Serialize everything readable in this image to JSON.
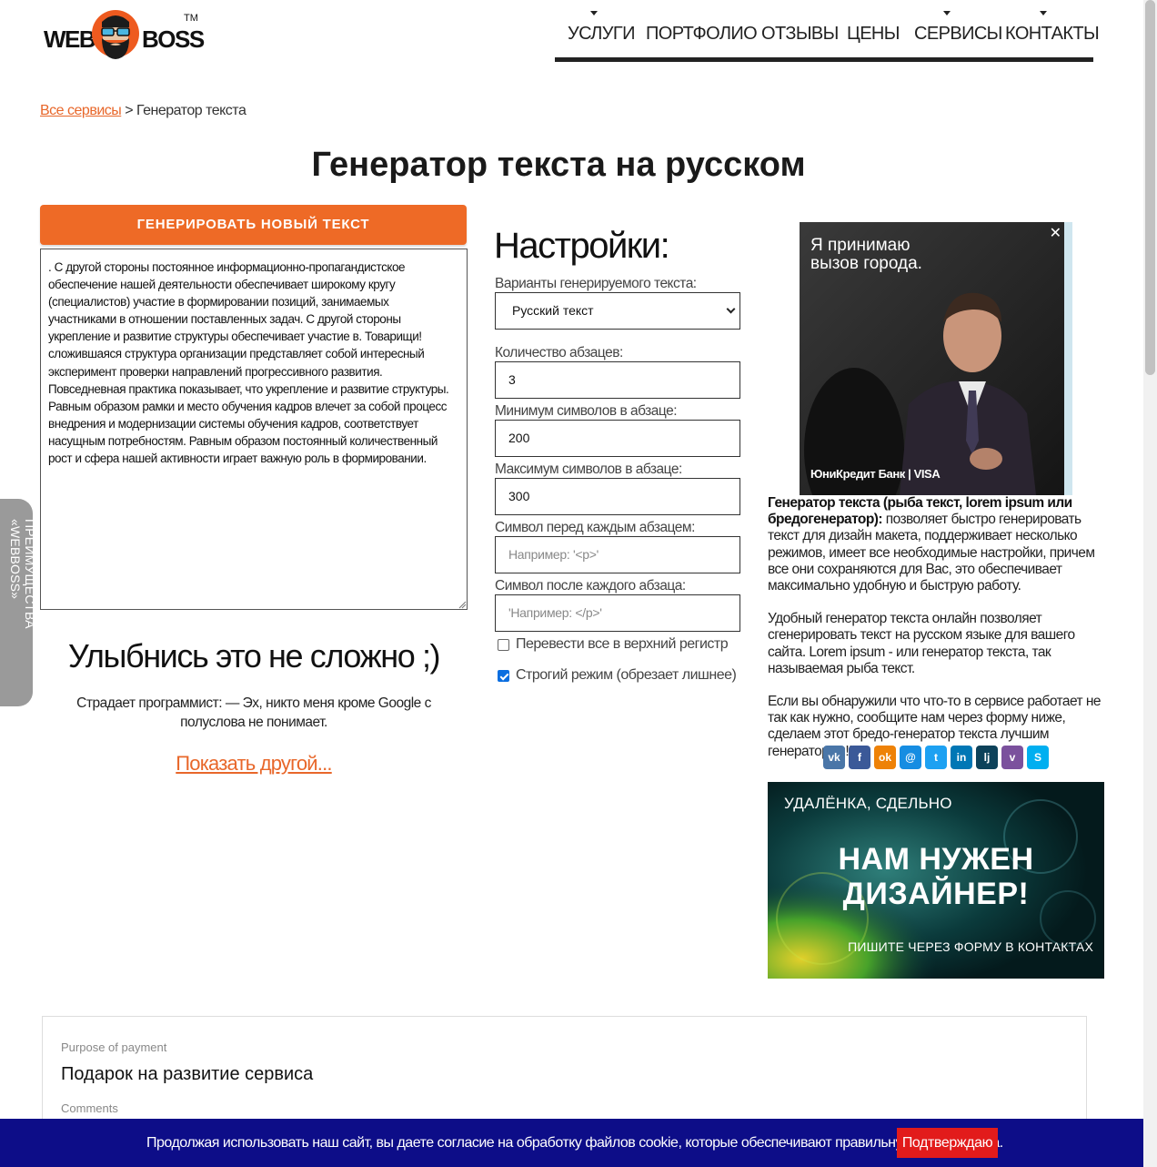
{
  "logo": {
    "left_text": "WEB",
    "right_text": "BOSS",
    "tm": "TM"
  },
  "nav": {
    "items": [
      {
        "label": "Услуги",
        "has_dropdown": true
      },
      {
        "label": "Портфолио",
        "has_dropdown": false
      },
      {
        "label": "Отзывы",
        "has_dropdown": false
      },
      {
        "label": "Цены",
        "has_dropdown": false
      },
      {
        "label": "Сервисы",
        "has_dropdown": true
      },
      {
        "label": "Контакты",
        "has_dropdown": true
      }
    ]
  },
  "breadcrumb": {
    "link": "Все сервисы",
    "separator": ">",
    "current": "Генератор текста"
  },
  "page_title": "Генератор текста на русском",
  "generator": {
    "button_label": "ГЕНЕРИРОВАТЬ НОВЫЙ ТЕКСТ",
    "output_text": ". С другой стороны постоянное информационно-пропагандистское обеспечение нашей деятельности обеспечивает широкому кругу (специалистов) участие в формировании позиций, занимаемых участниками в отношении поставленных задач. С другой стороны укрепление и развитие структуры обеспечивает участие в. Товарищи! сложившаяся структура организации представляет собой интересный эксперимент проверки направлений прогрессивного развития. Повседневная практика показывает, что укрепление и развитие структуры.\nРавным образом рамки и место обучения кадров влечет за собой процесс внедрения и модернизации системы обучения кадров, соответствует насущным потребностям. Равным образом постоянный количественный рост и сфера нашей активности играет важную роль в формировании."
  },
  "joke": {
    "title": "Улыбнись это не сложно ;)",
    "text": "Страдает программист: — Эх, никто меня кроме Google с полуслова не понимает.",
    "more_link": "Показать другой..."
  },
  "settings": {
    "title": "Настройки:",
    "variant_label": "Варианты генерируемого текста:",
    "variant_value": "Русский текст",
    "paragraphs_label": "Количество абзацев:",
    "paragraphs_value": "3",
    "min_label": "Минимум символов в абзаце:",
    "min_value": "200",
    "max_label": "Максимум символов в абзаце:",
    "max_value": "300",
    "before_label": "Символ перед каждым абзацем:",
    "before_placeholder": "Например: '<p>'",
    "after_label": "Символ после каждого абзаца:",
    "after_placeholder": "'Например: </p>'",
    "uppercase_label": "Перевести все в верхний регистр",
    "uppercase_checked": false,
    "strict_label": "Строгий режим (обрезает лишнее)",
    "strict_checked": true
  },
  "ad_top": {
    "text": "Я принимаю\nвызов города.",
    "brand": "ЮниКредит Банк | VISA",
    "close": "✕"
  },
  "description": {
    "bold": "Генератор текста (рыба текст, lorem ipsum или бредогенератор):",
    "p1": "позволяет быстро генерировать текст для дизайн макета, поддерживает несколько режимов, имеет все необходимые настройки, причем все они сохраняются для Вас, это обеспечивает максимально удобную и быструю работу.",
    "p2": "Удобный генератор текста онлайн позволяет сгенерировать текст на русском языке для вашего сайта. Lorem ipsum - или генератор текста, так называемая рыба текст.",
    "p3": "Если вы обнаружили что что-то в сервисе работает не так как нужно, сообщите нам через форму ниже, сделаем этот бредо-генератор текста лучшим генератором!!!"
  },
  "share": [
    {
      "name": "vkontakte",
      "glyph": "vk",
      "color": "#4a76a8"
    },
    {
      "name": "facebook",
      "glyph": "f",
      "color": "#3b5998"
    },
    {
      "name": "odnoklassniki",
      "glyph": "ok",
      "color": "#ee8208"
    },
    {
      "name": "moimir",
      "glyph": "@",
      "color": "#168de2"
    },
    {
      "name": "twitter",
      "glyph": "t",
      "color": "#1da1f2"
    },
    {
      "name": "linkedin",
      "glyph": "in",
      "color": "#0077b5"
    },
    {
      "name": "livejournal",
      "glyph": "lj",
      "color": "#0d425a"
    },
    {
      "name": "viber",
      "glyph": "v",
      "color": "#7b519d"
    },
    {
      "name": "skype",
      "glyph": "S",
      "color": "#00aff0"
    }
  ],
  "ad_bottom": {
    "top": "УДАЛЁНКА, СДЕЛЬНО",
    "main": "НАМ НУЖЕН\nДИЗАЙНЕР!",
    "bottom": "ПИШИТЕ ЧЕРЕЗ ФОРМУ В КОНТАКТАХ"
  },
  "side_tab": "ПРЕИМУЩЕСТВА «WEBBOSS»",
  "payment": {
    "purpose_label": "Purpose of payment",
    "purpose_value": "Подарок на развитие сервиса",
    "comments_label": "Comments"
  },
  "cookie": {
    "text": "Продолжая использовать наш сайт, вы даете согласие на обработку файлов cookie, которые обеспечивают правильную работу сайта.",
    "button": "Подтверждаю"
  },
  "colors": {
    "accent": "#ee6a26",
    "cookie_bar": "#0d0d88",
    "cookie_button": "#e21b1b",
    "checkbox": "#0b6ee0"
  }
}
